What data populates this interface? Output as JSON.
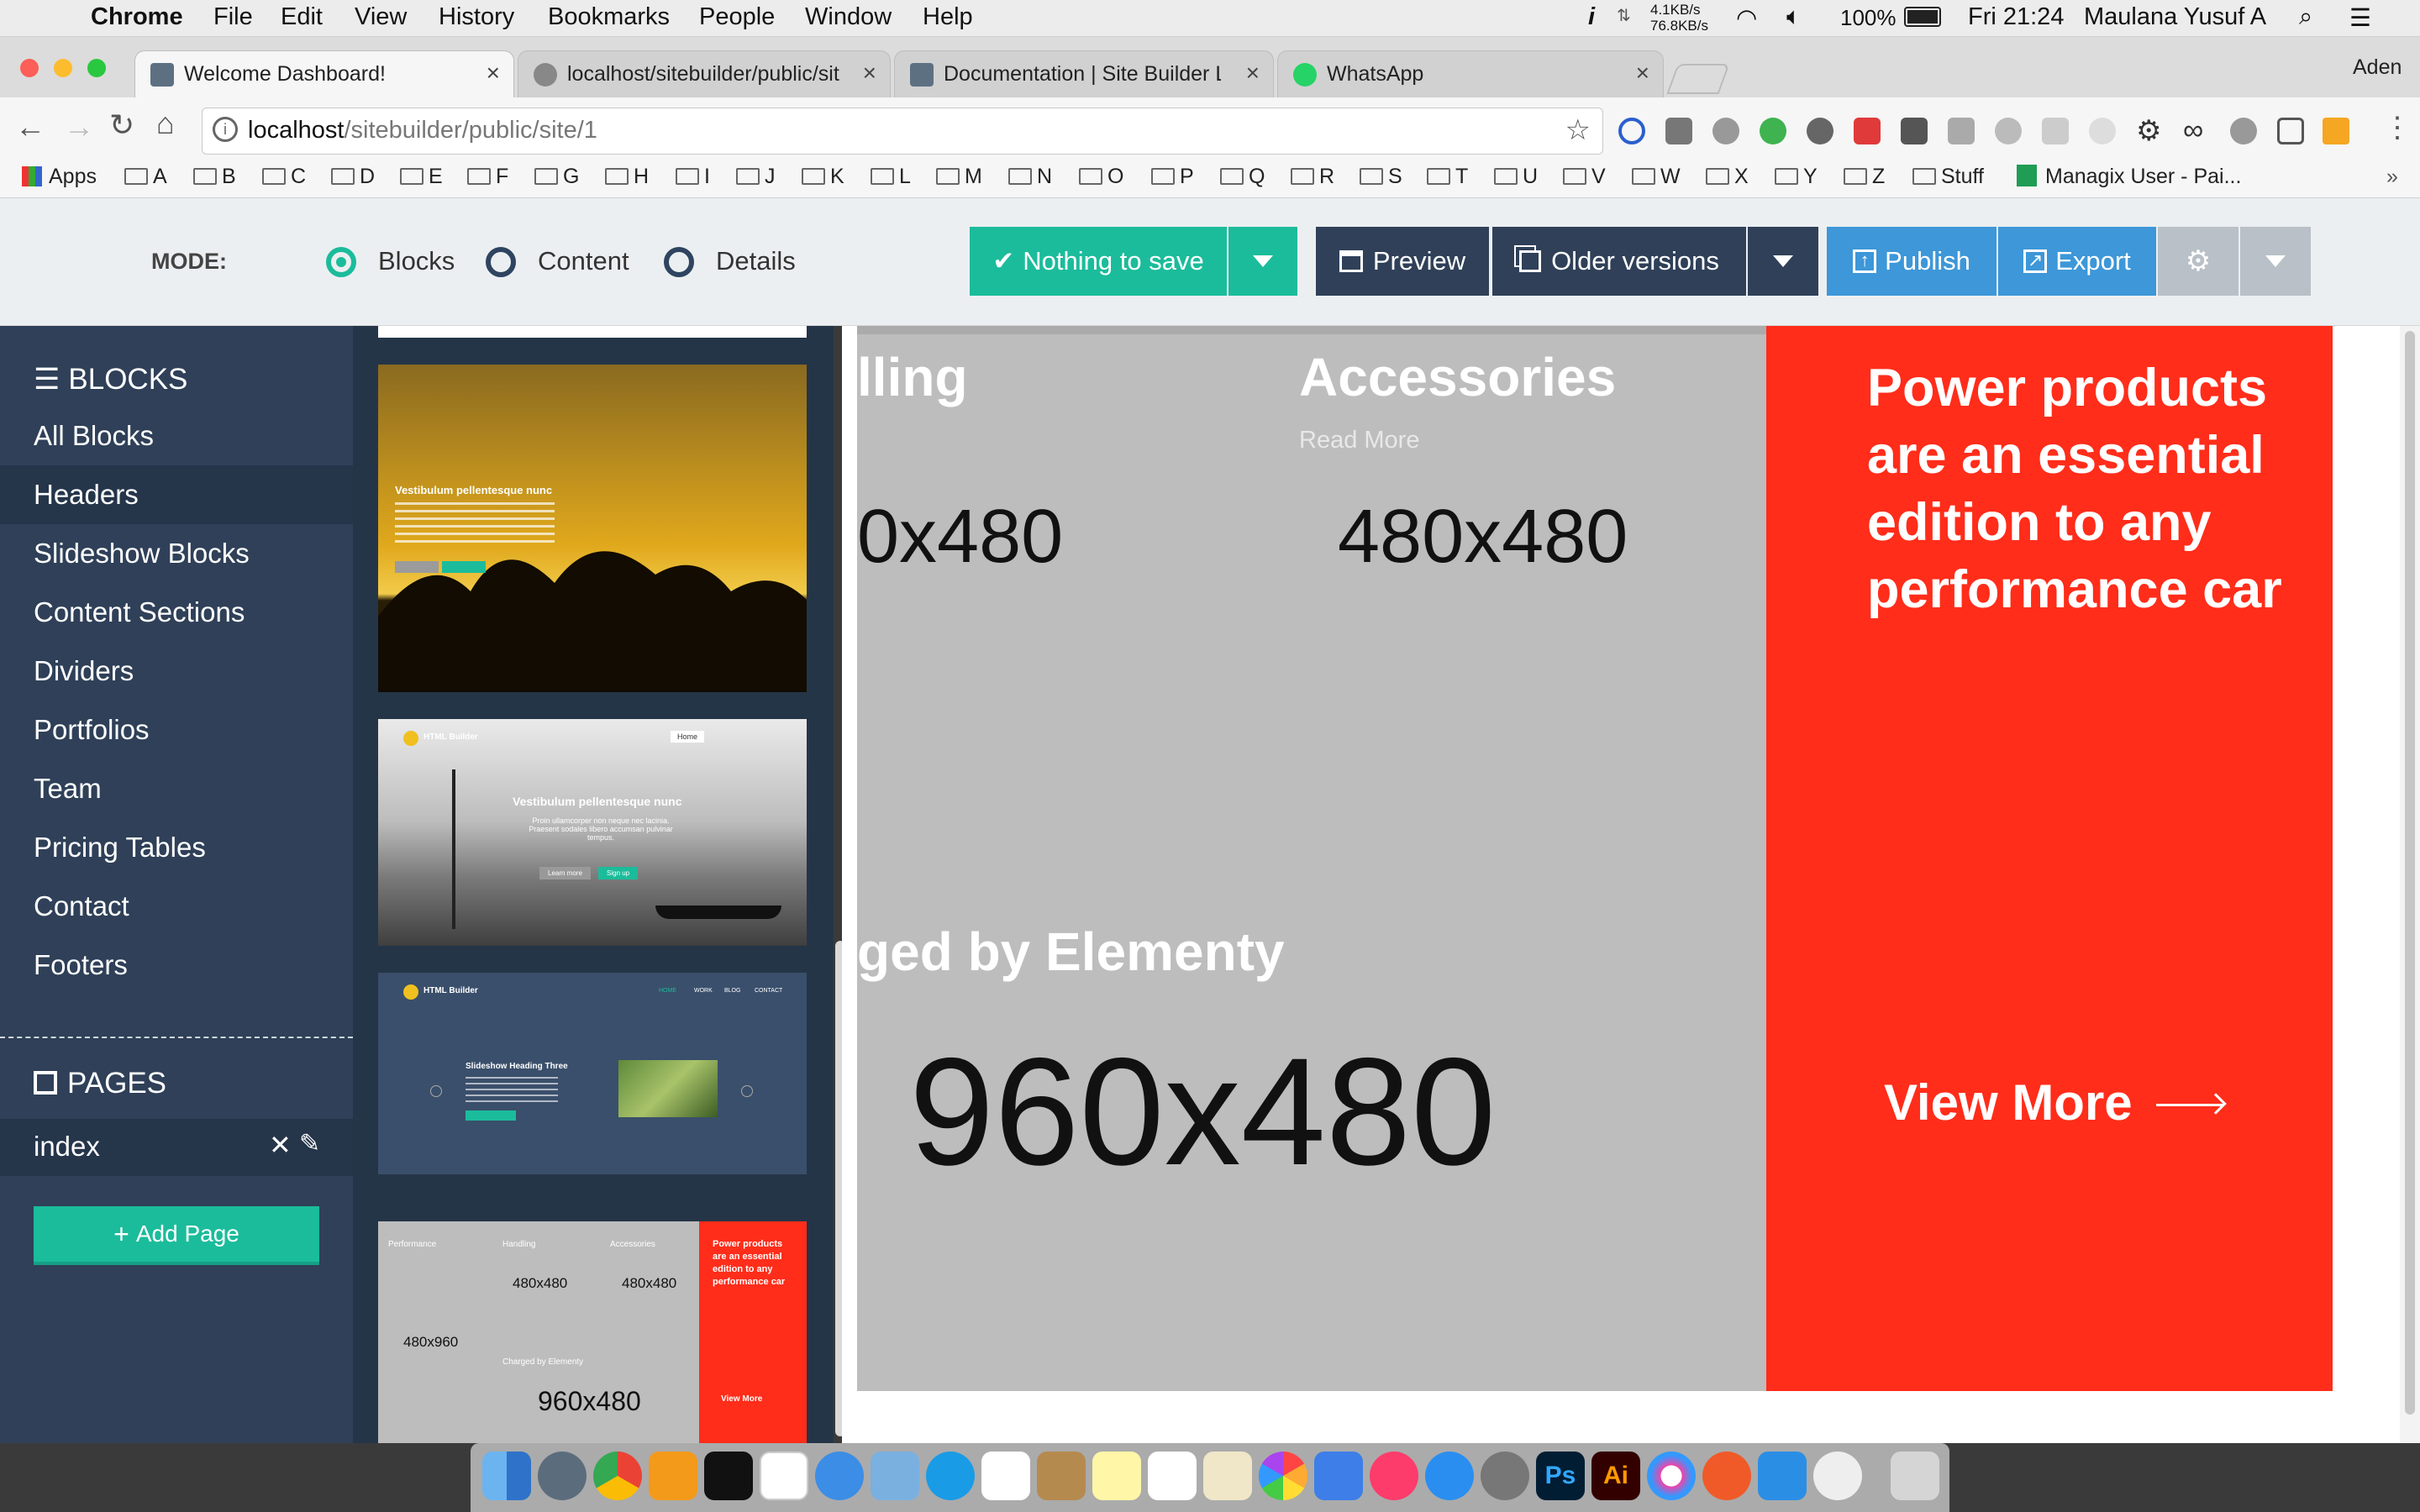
{
  "menubar": {
    "app": "Chrome",
    "menus": [
      "File",
      "Edit",
      "View",
      "History",
      "Bookmarks",
      "People",
      "Window",
      "Help"
    ],
    "net_up": "4.1KB/s",
    "net_down": "76.8KB/s",
    "battery": "100%",
    "clock": "Fri 21:24",
    "user": "Maulana Yusuf A"
  },
  "browser": {
    "tabs": [
      {
        "title": "Welcome Dashboard!",
        "active": true
      },
      {
        "title": "localhost/sitebuilder/public/sit"
      },
      {
        "title": "Documentation | Site Builder L"
      },
      {
        "title": "WhatsApp"
      }
    ],
    "profile": "Aden",
    "url_host": "localhost",
    "url_path": "/sitebuilder/public/site/1",
    "bookmarks": [
      "Apps",
      "A",
      "B",
      "C",
      "D",
      "E",
      "F",
      "G",
      "H",
      "I",
      "J",
      "K",
      "L",
      "M",
      "N",
      "O",
      "P",
      "Q",
      "R",
      "S",
      "T",
      "U",
      "V",
      "W",
      "X",
      "Y",
      "Z",
      "Stuff",
      "Managix User - Pai..."
    ],
    "more": "»"
  },
  "builder": {
    "mode_label": "MODE:",
    "modes": [
      {
        "label": "Blocks",
        "selected": true
      },
      {
        "label": "Content"
      },
      {
        "label": "Details"
      }
    ],
    "save_label": "Nothing to save",
    "preview_label": "Preview",
    "older_label": "Older versions",
    "publish_label": "Publish",
    "export_label": "Export"
  },
  "sidebar": {
    "blocks_title": "BLOCKS",
    "items": [
      "All Blocks",
      "Headers",
      "Slideshow Blocks",
      "Content Sections",
      "Dividers",
      "Portfolios",
      "Team",
      "Pricing Tables",
      "Contact",
      "Footers"
    ],
    "active_index": 1,
    "pages_title": "PAGES",
    "pages": [
      "index"
    ],
    "add_page": "Add Page"
  },
  "thumbs": {
    "t1_heading": "Vestibulum pellentesque nunc",
    "t2_brand": "HTML Builder",
    "t2_home": "Home",
    "t2_heading": "Vestibulum pellentesque nunc",
    "t2_text": "Proin ullamcorper non neque nec lacinia. Praesent sodales libero accumsan pulvinar tempus.",
    "t2_btn1": "Learn more",
    "t2_btn2": "Sign up",
    "t3_brand": "HTML Builder",
    "t3_nav": [
      "HOME",
      "WORK",
      "BLOG",
      "CONTACT"
    ],
    "t3_heading": "Slideshow Heading Three",
    "t4_labels": [
      "Performance",
      "Handling",
      "Accessories"
    ],
    "t4_sizes": [
      "480x480",
      "480x480",
      "480x960",
      "960x480"
    ],
    "t4_charged": "Charged by Elementy",
    "t4_red": "Power products are an essential edition to any performance car",
    "t4_view": "View More"
  },
  "preview": {
    "handling_partial": "lling",
    "accessories": "Accessories",
    "read_more": "Read More",
    "size_partial": "0x480",
    "size_480": "480x480",
    "charged_partial": "ged by Elementy",
    "size_960": "960x480",
    "red_text": "Power products are an essential edition to any performance car",
    "view_more": "View More"
  }
}
